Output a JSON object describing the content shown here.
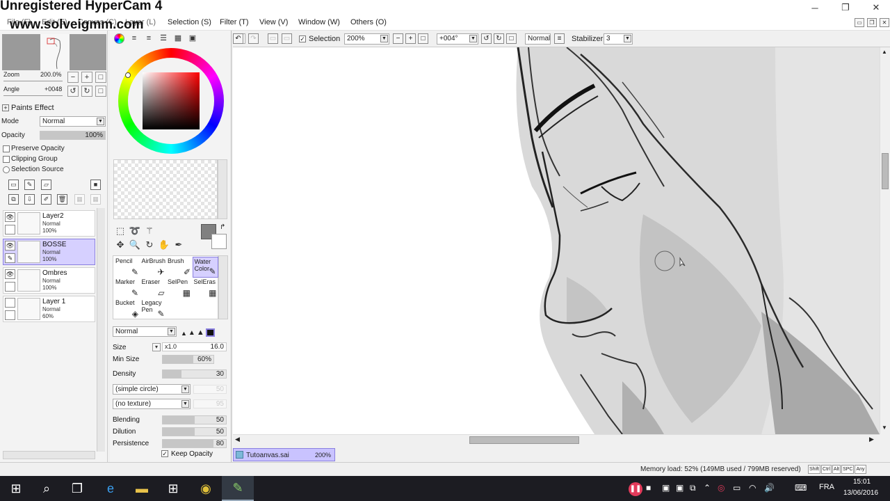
{
  "watermark": {
    "line1": "Unregistered HyperCam 4",
    "line2": "www.solveigmm.com"
  },
  "menu": [
    {
      "label": "File (F)",
      "name": "menu-file"
    },
    {
      "label": "Edit (E)",
      "name": "menu-edit"
    },
    {
      "label": "Canvas (C)",
      "name": "menu-canvas"
    },
    {
      "label": "Layer (L)",
      "name": "menu-layer"
    },
    {
      "label": "Selection (S)",
      "name": "menu-selection"
    },
    {
      "label": "Filter (T)",
      "name": "menu-filter"
    },
    {
      "label": "View (V)",
      "name": "menu-view"
    },
    {
      "label": "Window (W)",
      "name": "menu-window"
    },
    {
      "label": "Others (O)",
      "name": "menu-others"
    }
  ],
  "navigator": {
    "zoom_label": "Zoom",
    "zoom_value": "200.0%",
    "angle_label": "Angle",
    "angle_value": "+0048"
  },
  "paint_effect": {
    "title": "Paints Effect",
    "mode_label": "Mode",
    "mode_value": "Normal",
    "opacity_label": "Opacity",
    "opacity_value": "100%",
    "opacity_fraction": 1.0,
    "preserve_opacity": "Preserve Opacity",
    "clipping_group": "Clipping Group",
    "selection_source": "Selection Source"
  },
  "layers": [
    {
      "name": "Layer2",
      "mode": "Normal",
      "opacity": "100%",
      "selected": false,
      "visible": true
    },
    {
      "name": "BOSSE",
      "mode": "Normal",
      "opacity": "100%",
      "selected": true,
      "visible": true
    },
    {
      "name": "Ombres",
      "mode": "Normal",
      "opacity": "100%",
      "selected": false,
      "visible": true
    },
    {
      "name": "Layer 1",
      "mode": "Normal",
      "opacity": "60%",
      "selected": false,
      "visible": false
    }
  ],
  "brushes": [
    {
      "label": "Pencil",
      "glyph": "✎"
    },
    {
      "label": "AirBrush",
      "glyph": "✈"
    },
    {
      "label": "Brush",
      "glyph": "✐"
    },
    {
      "label": "Water\nColor",
      "glyph": "✎",
      "selected": true
    },
    {
      "label": "Marker",
      "glyph": "✎"
    },
    {
      "label": "Eraser",
      "glyph": "▱"
    },
    {
      "label": "SelPen",
      "glyph": "▦"
    },
    {
      "label": "SelEras",
      "glyph": "▦"
    },
    {
      "label": "Bucket",
      "glyph": "◈"
    },
    {
      "label": "Legacy\nPen",
      "glyph": "✎"
    }
  ],
  "brush_params": {
    "blend_mode": "Normal",
    "size_label": "Size",
    "size_mult": "x1.0",
    "size_value": "16.0",
    "min_size_label": "Min Size",
    "min_size_value": "60%",
    "min_size_fraction": 0.6,
    "density_label": "Density",
    "density_value": "30",
    "density_fraction": 0.3,
    "shape": "(simple circle)",
    "shape_value": "50",
    "texture": "(no texture)",
    "texture_value": "95",
    "blending_label": "Blending",
    "blending_value": "50",
    "blending_fraction": 0.5,
    "dilution_label": "Dilution",
    "dilution_value": "50",
    "dilution_fraction": 0.5,
    "persistence_label": "Persistence",
    "persistence_value": "80",
    "persistence_fraction": 0.8,
    "keep_opacity": "Keep Opacity"
  },
  "toolbar": {
    "selection_label": "Selection",
    "zoom": "200%",
    "angle": "+004°",
    "blend_mode": "Normal",
    "stabilizer_label": "Stabilizer",
    "stabilizer_value": "3"
  },
  "document_tab": {
    "name": "Tutoanvas.sai",
    "zoom": "200%"
  },
  "status": {
    "memory": "Memory load: 52% (149MB used / 799MB reserved)",
    "keys": [
      "Shift",
      "Ctrl",
      "Alt",
      "SPC",
      "Any"
    ]
  },
  "taskbar": {
    "lang": "FRA",
    "time": "15:01",
    "date": "13/06/2016"
  }
}
